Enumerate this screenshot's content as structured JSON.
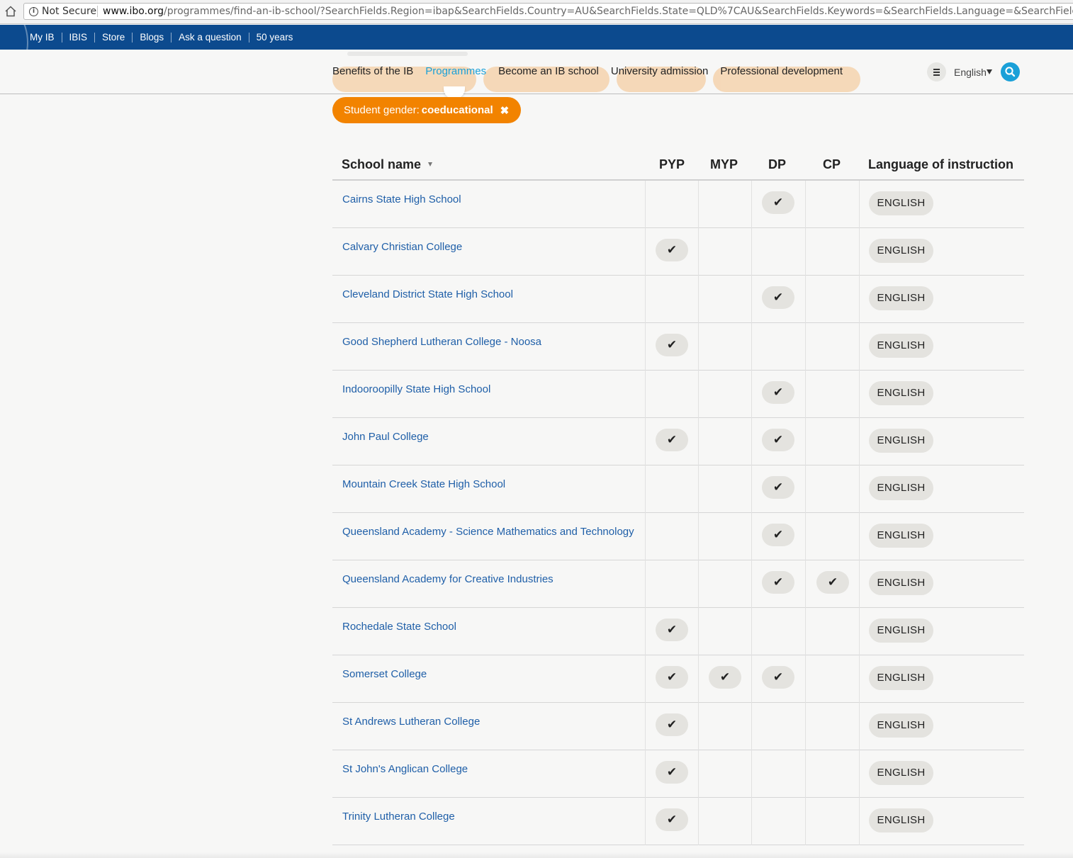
{
  "browser": {
    "security_label": "Not Secure",
    "url_host": "www.ibo.org",
    "url_path": "/programmes/find-an-ib-school/?SearchFields.Region=ibap&SearchFields.Country=AU&SearchFields.State=QLD%7CAU&SearchFields.Keywords=&SearchFields.Language=&SearchFields.BoardingFacilities=&SearchFields.SchoolGender=coeducational"
  },
  "utility_nav": [
    "My IB",
    "IBIS",
    "Store",
    "Blogs",
    "Ask a question",
    "50 years"
  ],
  "main_nav": {
    "items": [
      "Benefits of the IB",
      "Programmes",
      "Become an IB school",
      "University admission",
      "Professional development"
    ],
    "active": "Programmes",
    "language": "English"
  },
  "filter_chip": {
    "prefix": "Student gender:",
    "value": "coeducational",
    "remove": "✖"
  },
  "table": {
    "headers": {
      "school": "School name",
      "pyp": "PYP",
      "myp": "MYP",
      "dp": "DP",
      "cp": "CP",
      "language": "Language of instruction"
    },
    "check_glyph": "✔",
    "rows": [
      {
        "name": "Cairns State High School",
        "pyp": false,
        "myp": false,
        "dp": true,
        "cp": false,
        "language": "ENGLISH"
      },
      {
        "name": "Calvary Christian College",
        "pyp": true,
        "myp": false,
        "dp": false,
        "cp": false,
        "language": "ENGLISH"
      },
      {
        "name": "Cleveland District State High School",
        "pyp": false,
        "myp": false,
        "dp": true,
        "cp": false,
        "language": "ENGLISH"
      },
      {
        "name": "Good Shepherd Lutheran College - Noosa",
        "pyp": true,
        "myp": false,
        "dp": false,
        "cp": false,
        "language": "ENGLISH"
      },
      {
        "name": "Indooroopilly State High School",
        "pyp": false,
        "myp": false,
        "dp": true,
        "cp": false,
        "language": "ENGLISH"
      },
      {
        "name": "John Paul College",
        "pyp": true,
        "myp": false,
        "dp": true,
        "cp": false,
        "language": "ENGLISH"
      },
      {
        "name": "Mountain Creek State High School",
        "pyp": false,
        "myp": false,
        "dp": true,
        "cp": false,
        "language": "ENGLISH"
      },
      {
        "name": "Queensland Academy - Science Mathematics and Technology",
        "pyp": false,
        "myp": false,
        "dp": true,
        "cp": false,
        "language": "ENGLISH"
      },
      {
        "name": "Queensland Academy for Creative Industries",
        "pyp": false,
        "myp": false,
        "dp": true,
        "cp": true,
        "language": "ENGLISH"
      },
      {
        "name": "Rochedale State School",
        "pyp": true,
        "myp": false,
        "dp": false,
        "cp": false,
        "language": "ENGLISH"
      },
      {
        "name": "Somerset College",
        "pyp": true,
        "myp": true,
        "dp": true,
        "cp": false,
        "language": "ENGLISH"
      },
      {
        "name": "St Andrews Lutheran College",
        "pyp": true,
        "myp": false,
        "dp": false,
        "cp": false,
        "language": "ENGLISH"
      },
      {
        "name": "St John's Anglican College",
        "pyp": true,
        "myp": false,
        "dp": false,
        "cp": false,
        "language": "ENGLISH"
      },
      {
        "name": "Trinity Lutheran College",
        "pyp": true,
        "myp": false,
        "dp": false,
        "cp": false,
        "language": "ENGLISH"
      }
    ]
  },
  "colors": {
    "utility_bar": "#0c4a8e",
    "accent": "#1aa0d8",
    "chip": "#f28300",
    "link": "#1f5fa8"
  }
}
